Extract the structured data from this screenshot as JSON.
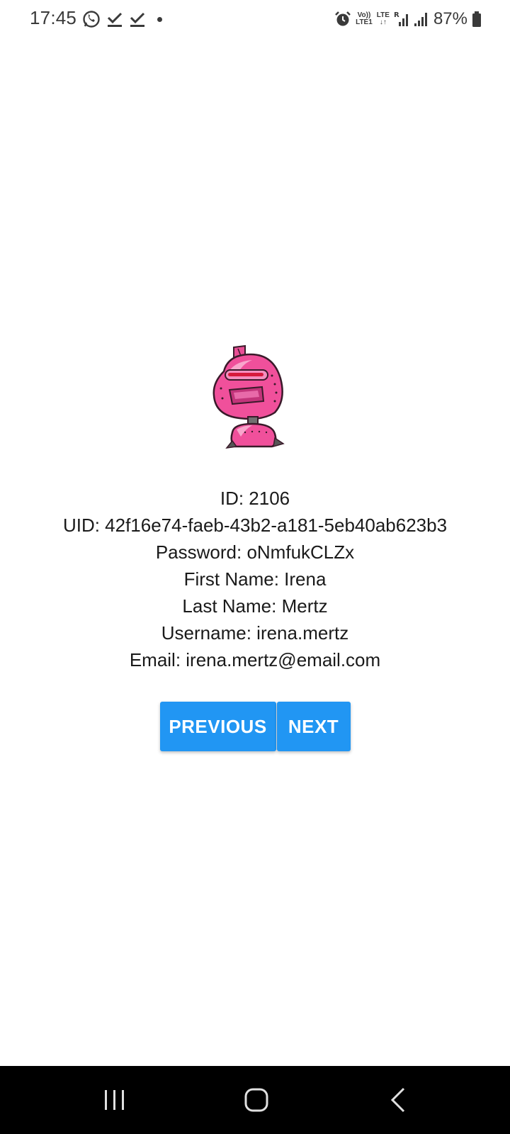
{
  "status_bar": {
    "time": "17:45",
    "left_icons": [
      "whatsapp-icon",
      "check-download-icon",
      "check-download-icon",
      "dot-icon"
    ],
    "right_icons": [
      "alarm-icon",
      "volte-icon",
      "lte-data-icon",
      "signal-r-icon",
      "signal-icon",
      "battery-icon"
    ],
    "volte_top": "Vo))",
    "volte_bottom": "LTE1",
    "lte_label": "LTE",
    "battery_pct": "87%"
  },
  "profile": {
    "id_line": "ID: 2106",
    "uid_line": "UID: 42f16e74-faeb-43b2-a181-5eb40ab623b3",
    "password_line": "Password: oNmfukCLZx",
    "first_name_line": "First Name: Irena",
    "last_name_line": "Last Name: Mertz",
    "username_line": "Username: irena.mertz",
    "email_line": "Email: irena.mertz@email.com"
  },
  "buttons": {
    "previous": "PREVIOUS",
    "next": "NEXT"
  },
  "colors": {
    "button": "#2196f3",
    "robot_pink": "#f0509b",
    "nav_bar": "#000000"
  }
}
